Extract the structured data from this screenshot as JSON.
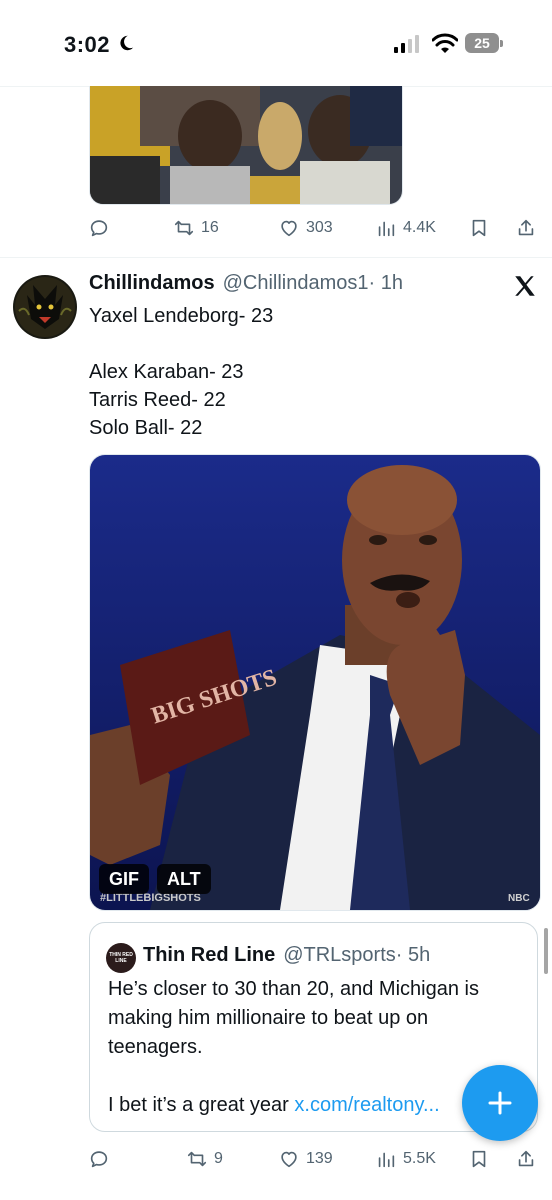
{
  "status_bar": {
    "time": "3:02",
    "battery": "25"
  },
  "previous_tweet": {
    "media": {
      "description_icon": "video-thumbnail"
    },
    "actions": {
      "retweets": "16",
      "likes": "303",
      "views": "4.4K"
    }
  },
  "tweet": {
    "display_name": "Chillindamos",
    "handle": "@Chillindamos1",
    "time": "· 1h",
    "lines": [
      "Yaxel Lendeborg- 23",
      "",
      "Alex Karaban- 23",
      "Tarris Reed- 22",
      "Solo Ball- 22"
    ],
    "media": {
      "gif_badge": "GIF",
      "alt_badge": "ALT",
      "card_text": "BIG SHOTS",
      "watermark": "#LITTLEBIGSHOTS",
      "network": "NBC"
    },
    "quoted": {
      "avatar_text": "THIN RED LINE",
      "display_name": "Thin Red Line",
      "handle": "@TRLsports",
      "time": "· 5h",
      "lines": [
        "He’s closer to 30 than 20, and Michigan is",
        "making him millionaire to beat up on",
        "teenagers.",
        ""
      ],
      "last_line_prefix": "I bet it’s a great year ",
      "link": "x.com/realtony..."
    },
    "actions": {
      "retweets": "9",
      "likes": "139",
      "views": "5.5K"
    }
  },
  "colors": {
    "accent": "#1d9bf0",
    "secondary_text": "#536471",
    "divider": "#eff3f4"
  },
  "icons": [
    "moon-icon",
    "signal-icon",
    "wifi-icon",
    "reply-icon",
    "retweet-icon",
    "like-icon",
    "views-icon",
    "bookmark-icon",
    "share-icon",
    "x-logo-icon",
    "compose-plus-icon"
  ]
}
